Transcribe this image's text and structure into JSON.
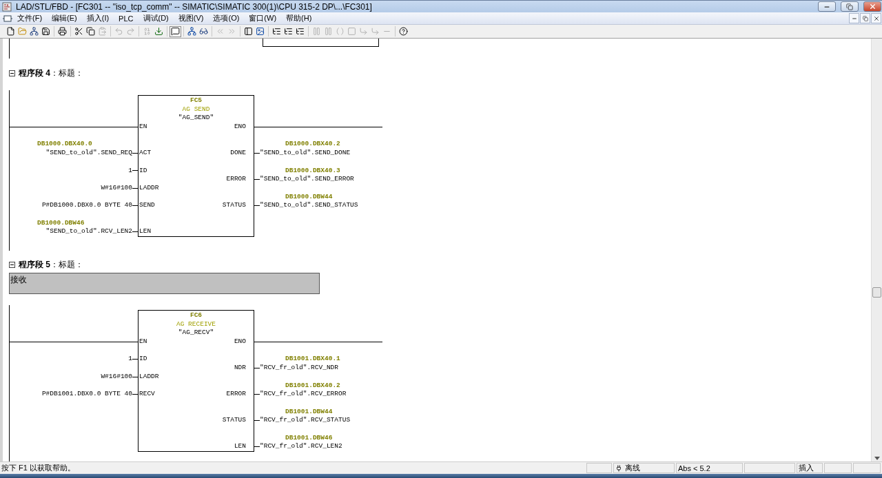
{
  "window": {
    "title": "LAD/STL/FBD  - [FC301 -- \"iso_tcp_comm\" -- SIMATIC\\SIMATIC 300(1)\\CPU 315-2 DP\\...\\FC301]"
  },
  "menu": [
    "文件(F)",
    "编辑(E)",
    "插入(I)",
    "PLC",
    "调试(D)",
    "视图(V)",
    "选项(O)",
    "窗口(W)",
    "帮助(H)"
  ],
  "toolbar": [
    [
      {
        "kind": "new",
        "disabled": false,
        "pressed": false
      },
      {
        "kind": "open",
        "disabled": false,
        "pressed": false
      },
      {
        "kind": "nodes",
        "disabled": false,
        "pressed": false
      },
      {
        "kind": "save",
        "disabled": false,
        "pressed": false
      }
    ],
    [
      {
        "kind": "print",
        "disabled": false,
        "pressed": false
      }
    ],
    [
      {
        "kind": "cut",
        "disabled": false,
        "pressed": false
      },
      {
        "kind": "copy",
        "disabled": false,
        "pressed": false
      },
      {
        "kind": "paste",
        "disabled": true,
        "pressed": false
      }
    ],
    [
      {
        "kind": "undo",
        "disabled": true,
        "pressed": false
      },
      {
        "kind": "redo",
        "disabled": true,
        "pressed": false
      }
    ],
    [
      {
        "kind": "compile",
        "disabled": true,
        "pressed": false
      },
      {
        "kind": "download",
        "disabled": false,
        "pressed": false
      }
    ],
    [
      {
        "kind": "message",
        "disabled": false,
        "pressed": true
      }
    ],
    [
      {
        "kind": "network",
        "disabled": false,
        "pressed": false
      },
      {
        "kind": "glasses",
        "disabled": false,
        "pressed": false
      }
    ],
    [
      {
        "kind": "prev",
        "disabled": true,
        "pressed": false
      },
      {
        "kind": "next",
        "disabled": true,
        "pressed": false
      }
    ],
    [
      {
        "kind": "panel",
        "disabled": false,
        "pressed": false
      },
      {
        "kind": "image",
        "disabled": false,
        "pressed": false
      }
    ],
    [
      {
        "kind": "tree",
        "disabled": false,
        "pressed": false
      },
      {
        "kind": "tree",
        "disabled": false,
        "pressed": false
      },
      {
        "kind": "tree",
        "disabled": false,
        "pressed": false
      }
    ],
    [
      {
        "kind": "contact",
        "disabled": true,
        "pressed": false
      },
      {
        "kind": "contact",
        "disabled": true,
        "pressed": false
      },
      {
        "kind": "coil",
        "disabled": true,
        "pressed": false
      },
      {
        "kind": "box",
        "disabled": true,
        "pressed": false
      },
      {
        "kind": "branch",
        "disabled": true,
        "pressed": false
      },
      {
        "kind": "branch",
        "disabled": true,
        "pressed": false
      },
      {
        "kind": "jump",
        "disabled": true,
        "pressed": false
      }
    ],
    [
      {
        "kind": "help",
        "disabled": false,
        "pressed": false
      }
    ]
  ],
  "networks": [
    {
      "title": "**程序段  4**：标题：",
      "expanded": true,
      "block": {
        "number": "FC5",
        "type": "AG SEND",
        "name": "\"AG_SEND\"",
        "en": "EN",
        "eno": "ENO",
        "inputs": [
          {
            "pin": "ACT",
            "operand": "\"SEND_to_old\".SEND_REQ",
            "address": "DB1000.DBX40.0"
          },
          {
            "pin": "ID",
            "operand": "1"
          },
          {
            "pin": "LADDR",
            "operand": "W#16#100"
          },
          {
            "pin": "SEND",
            "operand": "P#DB1000.DBX0.0 BYTE 40"
          },
          {
            "pin": "LEN",
            "operand": "\"SEND_to_old\".RCV_LEN2",
            "address": "DB1000.DBW46"
          }
        ],
        "outputs": [
          {
            "pin": "DONE",
            "operand": "\"SEND_to_old\".SEND_DONE",
            "address": "DB1000.DBX40.2"
          },
          {
            "pin": "ERROR",
            "operand": "\"SEND_to_old\".SEND_ERROR",
            "address": "DB1000.DBX40.3"
          },
          {
            "pin": "STATUS",
            "operand": "\"SEND_to_old\".SEND_STATUS",
            "address": "DB1000.DBW44"
          }
        ]
      }
    },
    {
      "title": "**程序段  5**：标题：",
      "expanded": true,
      "comment": "接收",
      "block": {
        "number": "FC6",
        "type": "AG RECEIVE",
        "name": "\"AG_RECV\"",
        "en": "EN",
        "eno": "ENO",
        "inputs": [
          {
            "pin": "ID",
            "operand": "1"
          },
          {
            "pin": "LADDR",
            "operand": "W#16#100"
          },
          {
            "pin": "RECV",
            "operand": "P#DB1001.DBX0.0 BYTE 40"
          }
        ],
        "outputs": [
          {
            "pin": "NDR",
            "operand": "\"RCV_fr_old\".RCV_NDR",
            "address": "DB1001.DBX40.1"
          },
          {
            "pin": "ERROR",
            "operand": "\"RCV_fr_old\".RCV_ERROR",
            "address": "DB1001.DBX40.2"
          },
          {
            "pin": "STATUS",
            "operand": "\"RCV_fr_old\".RCV_STATUS",
            "address": "DB1001.DBW44"
          },
          {
            "pin": "LEN",
            "operand": "\"RCV_fr_old\".RCV_LEN2",
            "address": "DB1001.DBW46"
          }
        ]
      }
    }
  ],
  "status_bar": {
    "hint": "按下 F1 以获取帮助。",
    "mode": "离线",
    "version": "Abs < 5.2",
    "edit_mode": "插入"
  }
}
